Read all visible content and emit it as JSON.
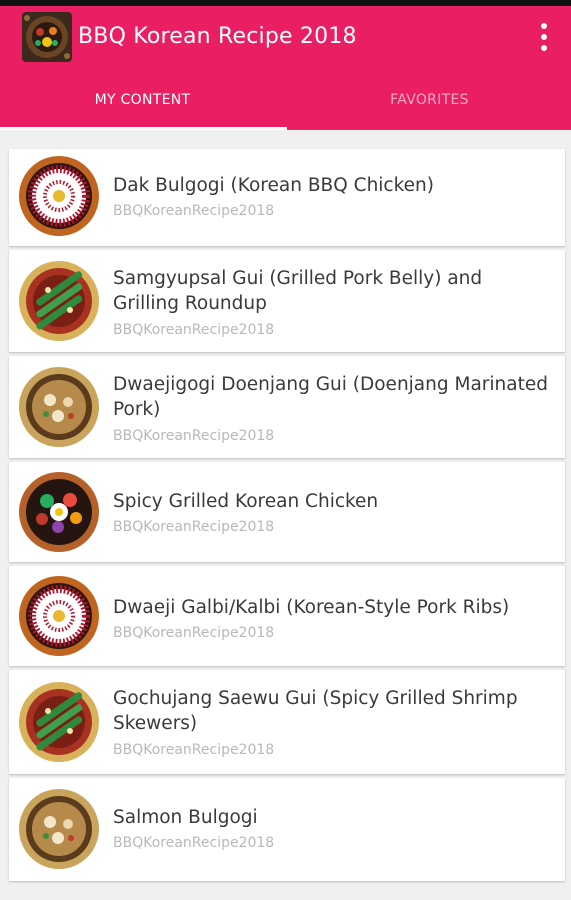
{
  "app": {
    "title": "BBQ Korean Recipe 2018",
    "icon": "app-logo-icon",
    "menu_icon": "overflow-menu-icon",
    "accent_color": "#e91e63"
  },
  "tabs": [
    {
      "label": "MY CONTENT",
      "selected": true
    },
    {
      "label": "FAVORITES",
      "selected": false
    }
  ],
  "recipes": [
    {
      "title": "Dak Bulgogi (Korean BBQ Chicken)",
      "subtitle": "BBQKoreanRecipe2018",
      "thumb": "red-rim-bowl-icon"
    },
    {
      "title": "Samgyupsal Gui (Grilled Pork Belly) and Grilling Roundup",
      "subtitle": "BBQKoreanRecipe2018",
      "thumb": "green-skewer-bowl-icon"
    },
    {
      "title": "Dwaejigogi Doenjang Gui (Doenjang Marinated Pork)",
      "subtitle": "BBQKoreanRecipe2018",
      "thumb": "stew-bowl-icon"
    },
    {
      "title": "Spicy Grilled Korean Chicken",
      "subtitle": "BBQKoreanRecipe2018",
      "thumb": "bibimbap-bowl-icon"
    },
    {
      "title": "Dwaeji Galbi/Kalbi (Korean-Style Pork Ribs)",
      "subtitle": "BBQKoreanRecipe2018",
      "thumb": "red-rim-bowl-icon"
    },
    {
      "title": "Gochujang Saewu Gui (Spicy Grilled Shrimp Skewers)",
      "subtitle": "BBQKoreanRecipe2018",
      "thumb": "green-skewer-bowl-icon"
    },
    {
      "title": "Salmon Bulgogi",
      "subtitle": "BBQKoreanRecipe2018",
      "thumb": "stew-bowl-icon"
    }
  ]
}
